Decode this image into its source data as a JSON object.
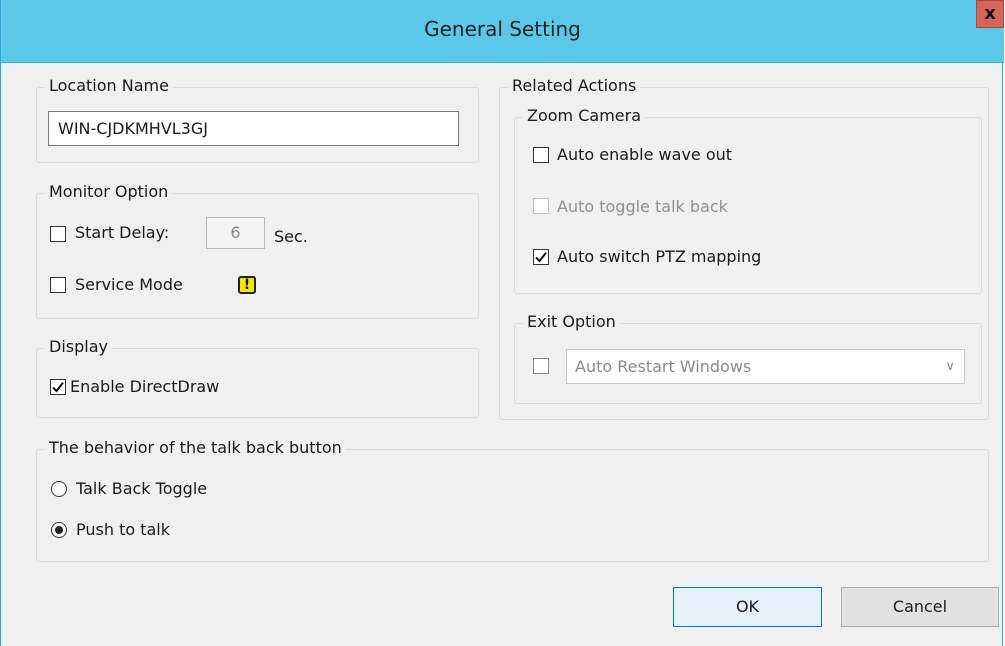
{
  "window": {
    "title": "General Setting",
    "close_label": "x"
  },
  "location": {
    "legend": "Location Name",
    "value": "WIN-CJDKMHVL3GJ"
  },
  "monitor": {
    "legend": "Monitor Option",
    "start_delay_label": "Start Delay:",
    "start_delay_checked": false,
    "delay_value": "6",
    "delay_unit": "Sec.",
    "service_mode_label": "Service Mode",
    "service_mode_checked": false,
    "warning_glyph": "!"
  },
  "display": {
    "legend": "Display",
    "direct_draw_label": "Enable DirectDraw",
    "direct_draw_checked": true
  },
  "related": {
    "legend": "Related Actions",
    "zoom": {
      "legend": "Zoom Camera",
      "items": [
        {
          "label": "Auto enable wave out",
          "checked": false,
          "enabled": true
        },
        {
          "label": "Auto toggle talk back",
          "checked": false,
          "enabled": false
        },
        {
          "label": "Auto switch PTZ mapping",
          "checked": true,
          "enabled": true
        }
      ]
    },
    "exit": {
      "legend": "Exit Option",
      "checked": false,
      "combo_value": "Auto Restart Windows"
    }
  },
  "talkback": {
    "legend": "The behavior of the talk back button",
    "options": [
      {
        "label": "Talk Back Toggle",
        "selected": false
      },
      {
        "label": "Push to talk",
        "selected": true
      }
    ]
  },
  "buttons": {
    "ok": "OK",
    "cancel": "Cancel"
  },
  "colors": {
    "titlebar": "#5bc8ea",
    "close": "#d4655a",
    "background": "#f0f0f0",
    "default_button_border": "#0078d7"
  }
}
